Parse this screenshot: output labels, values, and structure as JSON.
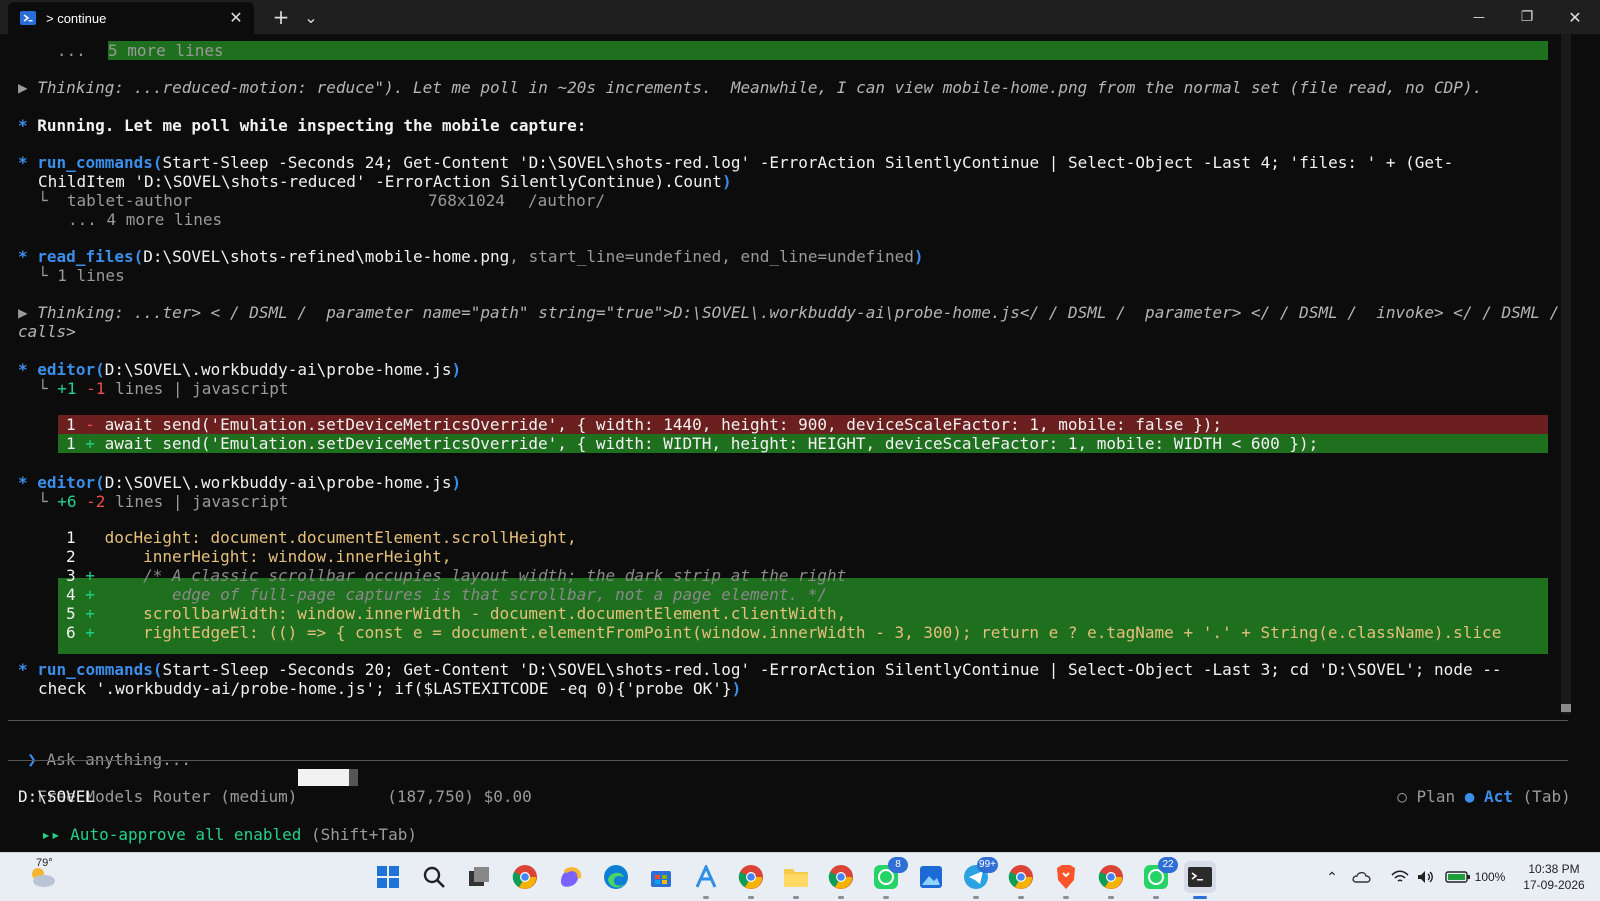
{
  "window": {
    "tab_title": "> continue",
    "tab_close": "✕",
    "new_tab": "+",
    "dropdown": "⌄",
    "minimize": "—",
    "maximize": "❐",
    "close": "✕"
  },
  "terminal": {
    "l1_prefix": "   ... ",
    "l1_text": "5 more lines",
    "thinking1": "Thinking: ...reduced-motion: reduce\"). Let me poll in ~20s increments.  Meanwhile, I can view mobile-home.png from the normal set (file read, no CDP).",
    "thinking_marker": "▶",
    "running": "Running. Let me poll while inspecting the mobile capture:",
    "bullet": "*",
    "cmd1_name": "run_commands",
    "cmd1_args_a": "Start-Sleep -Seconds 24; Get-Content 'D:\\SOVEL\\shots-red.log' -ErrorAction SilentlyContinue | Select-Object -Last 4; 'files: ' + (Get-",
    "cmd1_args_b": "ChildItem 'D:\\SOVEL\\shots-reduced' -ErrorAction SilentlyContinue).Count",
    "cmd1_out_name": "tablet-author",
    "cmd1_out_size": "768x1024",
    "cmd1_out_path": "/author/",
    "cmd1_more": "... 4 more lines",
    "read_name": "read_files",
    "read_path": "D:\\SOVEL\\shots-refined\\mobile-home.png",
    "read_params": ", start_line=undefined, end_line=undefined",
    "read_result": "1 lines",
    "thinking2_a": "Thinking: ...ter> < / DSML /  parameter name=\"path\" string=\"true\">D:\\SOVEL\\.workbuddy-ai\\probe-home.js</ / DSML /  parameter> </ / DSML /  invoke> </ / DSML /",
    "thinking2_b": "calls>",
    "editor_name": "editor",
    "editor_path": "D:\\SOVEL\\.workbuddy-ai\\probe-home.js",
    "edit1_plus": "+1",
    "edit1_minus": "-1",
    "edit1_rest": " lines | javascript",
    "diff1_del_num": "1",
    "diff1_del_sign": "-",
    "diff1_add_num": "1",
    "diff1_add_sign": "+",
    "diff1_del_code": "await send('Emulation.setDeviceMetricsOverride', { width: 1440, height: 900, deviceScaleFactor: 1, mobile: false });",
    "diff1_add_code": "await send('Emulation.setDeviceMetricsOverride', { width: WIDTH, height: HEIGHT, deviceScaleFactor: 1, mobile: WIDTH < 600 });",
    "edit2_plus": "+6",
    "edit2_minus": "-2",
    "edit2_rest": " lines | javascript",
    "code_lines": [
      {
        "num": "1",
        "sign": " ",
        "code": "docHeight: document.documentElement.scrollHeight,"
      },
      {
        "num": "2",
        "sign": " ",
        "code": "    innerHeight: window.innerHeight,"
      },
      {
        "num": "3",
        "sign": "+",
        "code": "    /* A classic scrollbar occupies layout width; the dark strip at the right"
      },
      {
        "num": "4",
        "sign": "+",
        "code": "       edge of full-page captures is that scrollbar, not a page element. */"
      },
      {
        "num": "5",
        "sign": "+",
        "code": "    scrollbarWidth: window.innerWidth - document.documentElement.clientWidth,"
      },
      {
        "num": "6",
        "sign": "+",
        "code": "    rightEdgeEl: (() => { const e = document.elementFromPoint(window.innerWidth - 3, 300); return e ? e.tagName + '.' + String(e.className).slice"
      }
    ],
    "cmd2_name": "run_commands",
    "cmd2_args_a": "Start-Sleep -Seconds 20; Get-Content 'D:\\SOVEL\\shots-red.log' -ErrorAction SilentlyContinue | Select-Object -Last 3; cd 'D:\\SOVEL'; node --",
    "cmd2_args_b": "check '.workbuddy-ai/probe-home.js'; if($LASTEXITCODE -eq 0){'probe OK'}"
  },
  "input": {
    "prompt_glyph": "❯",
    "placeholder": "Ask anything..."
  },
  "status": {
    "model": "Free Models Router (medium)",
    "tokens": "(187,750)",
    "cost": "$0.00",
    "context_fill": 0.85,
    "plan_label": "Plan",
    "act_label": "Act",
    "tab_hint": "(Tab)",
    "cwd": "D:\\SOVEL",
    "auto_marker": "▸▸",
    "auto_approve": "Auto-approve all enabled",
    "auto_hint": "(Shift+Tab)"
  },
  "taskbar": {
    "weather": "79°",
    "badges": {
      "whatsapp1": "8",
      "telegram": "99+",
      "whatsapp2": "22"
    },
    "battery": "100%",
    "time": "10:38 PM",
    "date": "17-09-2026"
  },
  "colors": {
    "terminal_bg": "#0c0c0c",
    "diff_add_bg": "#1e6f1e",
    "diff_del_bg": "#6b1f1f",
    "accent_blue": "#3b8eea"
  }
}
